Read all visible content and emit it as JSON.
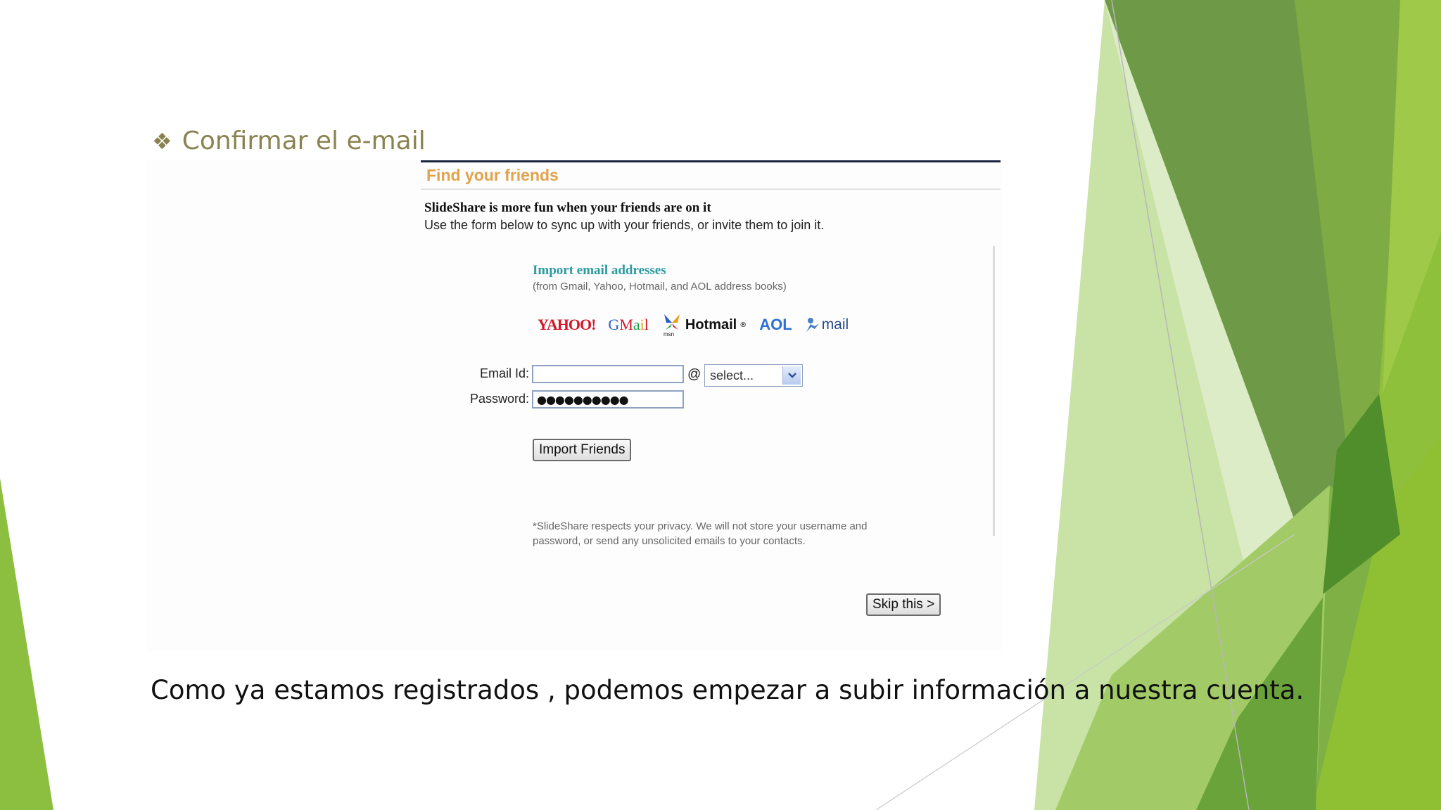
{
  "slide": {
    "bullet_symbol": "❖",
    "heading": "Confirmar el e-mail",
    "caption": "Como ya estamos registrados , podemos empezar a subir información a nuestra cuenta."
  },
  "screenshot": {
    "title": "Find your friends",
    "heading": "SlideShare is more fun when your friends are on it",
    "subheading": "Use the form below to sync up with your friends, or invite them to join it.",
    "import_title": "Import email addresses",
    "import_subtitle": "(from Gmail, Yahoo, Hotmail, and AOL address books)",
    "logos": {
      "yahoo": "YAHOO!",
      "gmail": "GMail",
      "msn": "msn",
      "hotmail": "Hotmail",
      "hotmail_mark": "®",
      "aol": "AOL",
      "aol_mail": "mail"
    },
    "email_label": "Email Id:",
    "email_value": "",
    "at_sign": "@",
    "domain_select": "select...",
    "password_label": "Password:",
    "password_value": "●●●●●●●●●●",
    "import_button": "Import Friends",
    "privacy_line1": "*SlideShare respects your privacy. We will not store your username and",
    "privacy_line2": "password, or send any unsolicited emails to your contacts.",
    "skip_button": "Skip this >"
  },
  "colors": {
    "heading_olive": "#8a8350",
    "title_orange": "#e2a24a",
    "import_teal": "#2b9aa0",
    "green_dark": "#6e9a48",
    "green_mid": "#7db043",
    "green_light": "#9bc94a"
  }
}
